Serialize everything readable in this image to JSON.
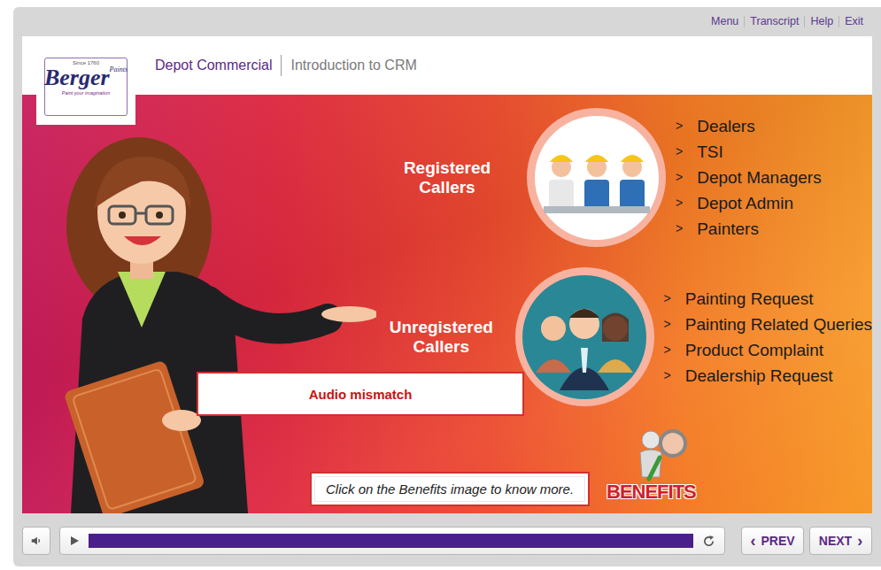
{
  "top_links": [
    {
      "label": "Menu"
    },
    {
      "label": "Transcript"
    },
    {
      "label": "Help"
    },
    {
      "label": "Exit"
    }
  ],
  "header": {
    "logo": {
      "since": "Since 1760",
      "brand": "Berger",
      "script": "Paints",
      "tagline": "Paint your imagination"
    },
    "course": "Depot Commercial",
    "module": "Introduction to CRM"
  },
  "slide": {
    "bullet": ">",
    "groups": [
      {
        "label": "Registered Callers",
        "kind": "registered",
        "items": [
          "Dealers",
          "TSI",
          "Depot Managers",
          "Depot Admin",
          "Painters"
        ]
      },
      {
        "label": "Unregistered Callers",
        "kind": "unregistered",
        "items": [
          "Painting Request",
          "Painting Related Queries",
          "Product Complaint",
          "Dealership Request"
        ]
      }
    ],
    "notice": "Audio mismatch",
    "hint": "Click on the Benefits image to know more.",
    "benefits": "BENEFITS"
  },
  "player": {
    "level": 1,
    "prev": {
      "icon": "‹",
      "label": "PREV"
    },
    "next": {
      "label": "NEXT",
      "icon": "›"
    }
  }
}
